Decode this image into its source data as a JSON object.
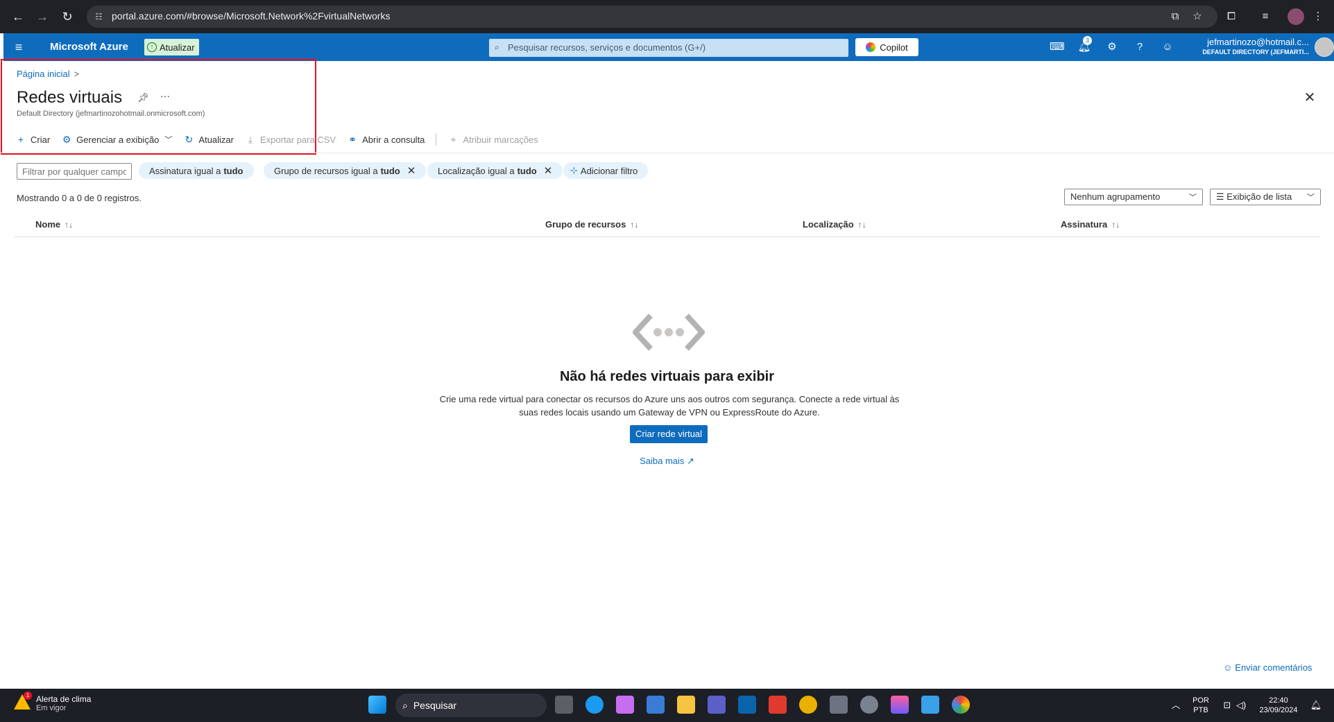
{
  "browser": {
    "url": "portal.azure.com/#browse/Microsoft.Network%2FvirtualNetworks"
  },
  "azure": {
    "brand": "Microsoft Azure",
    "upgrade_label": "Atualizar",
    "search_placeholder": "Pesquisar recursos, serviços e documentos (G+/)",
    "copilot_label": "Copilot",
    "notification_count": "3",
    "account_email": "jefmartinozo@hotmail.c...",
    "account_directory": "DEFAULT DIRECTORY (JEFMARTI..."
  },
  "page": {
    "breadcrumb_home": "Página inicial",
    "breadcrumb_sep": ">",
    "title": "Redes virtuais",
    "subtitle": "Default Directory (jefmartinozohotmail.onmicrosoft.com)",
    "commands": {
      "create": "Criar",
      "manage_view": "Gerenciar a exibição",
      "refresh": "Atualizar",
      "export_csv": "Exportar para CSV",
      "open_query": "Abrir a consulta",
      "assign_tags": "Atribuir marcações"
    },
    "filter_placeholder": "Filtrar por qualquer campo...",
    "filters": [
      {
        "label": "Assinatura igual a",
        "value": "tudo"
      },
      {
        "label": "Grupo de recursos igual a",
        "value": "tudo"
      },
      {
        "label": "Localização igual a",
        "value": "tudo"
      }
    ],
    "add_filter": "Adicionar filtro",
    "records": "Mostrando 0 a 0 de 0 registros.",
    "grouping": "Nenhum agrupamento",
    "view_mode": "Exibição de lista",
    "columns": [
      "Nome",
      "Grupo de recursos",
      "Localização",
      "Assinatura"
    ],
    "empty_title": "Não há redes virtuais para exibir",
    "empty_desc": "Crie uma rede virtual para conectar os recursos do Azure uns aos outros com segurança. Conecte a rede virtual às suas redes locais usando um Gateway de VPN ou ExpressRoute do Azure.",
    "create_button": "Criar rede virtual",
    "learn_more": "Saiba mais",
    "feedback": "Enviar comentários"
  },
  "taskbar": {
    "weather_title": "Alerta de clima",
    "weather_sub": "Em vigor",
    "weather_badge": "1",
    "search_label": "Pesquisar",
    "lang_line1": "POR",
    "lang_line2": "PTB",
    "time": "22:40",
    "date": "23/09/2024"
  },
  "colors": {
    "azure_blue": "#0f6cbd",
    "highlight_red": "#e81123"
  }
}
